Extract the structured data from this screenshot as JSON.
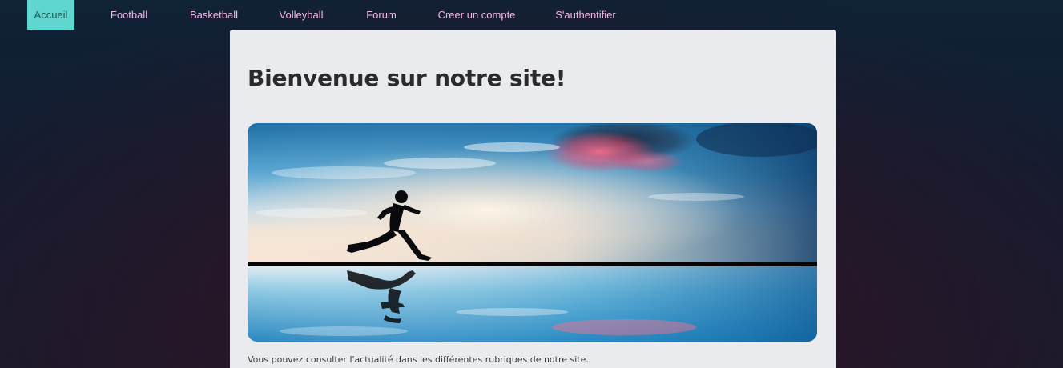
{
  "nav": {
    "items": [
      {
        "label": "Accueil",
        "active": true
      },
      {
        "label": "Football",
        "active": false
      },
      {
        "label": "Basketball",
        "active": false
      },
      {
        "label": "Volleyball",
        "active": false
      },
      {
        "label": "Forum",
        "active": false
      },
      {
        "label": "Creer un compte",
        "active": false
      },
      {
        "label": "S'authentifier",
        "active": false
      }
    ]
  },
  "main": {
    "title": "Bienvenue sur notre site!",
    "hero_image": "runner-silhouette-sunset-water",
    "caption": "Vous pouvez consulter l'actualité dans les différentes rubriques de notre site."
  },
  "colors": {
    "nav_active_bg": "#5fd6cf",
    "nav_link": "#f2b6e6",
    "card_bg": "#e9ebee",
    "page_bg": "#141c30"
  }
}
